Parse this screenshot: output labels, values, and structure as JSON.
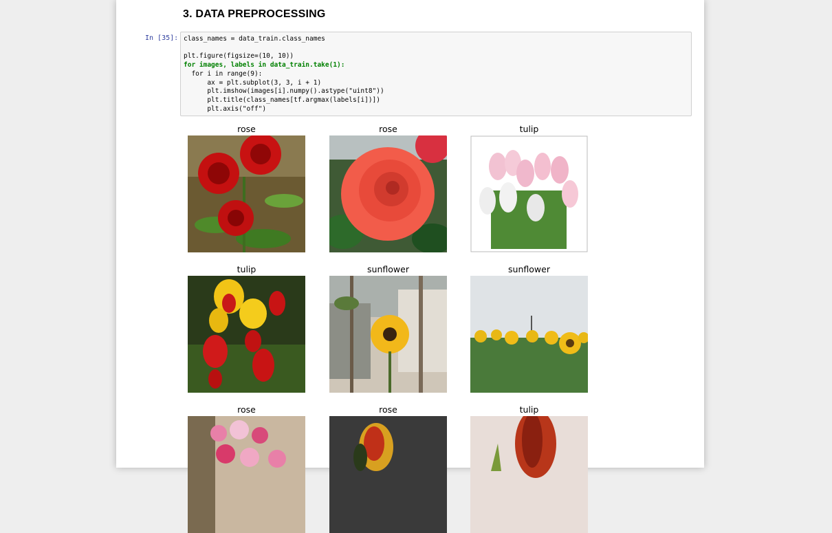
{
  "section": {
    "heading": "3. DATA PREPROCESSING"
  },
  "cell": {
    "prompt": "In [35]:",
    "code_lines": {
      "l1": "class_names = data_train.class_names",
      "l2": "plt.figure(figsize=(10, 10))",
      "l3": "for images, labels in data_train.take(1):",
      "l4": "  for i in range(9):",
      "l5": "      ax = plt.subplot(3, 3, i + 1)",
      "l6": "      plt.imshow(images[i].numpy().astype(\"uint8\"))",
      "l7": "      plt.title(class_names[tf.argmax(labels[i])])",
      "l8": "      plt.axis(\"off\")"
    }
  },
  "output": {
    "images": [
      {
        "title": "rose",
        "icon": "red-roses-image"
      },
      {
        "title": "rose",
        "icon": "orange-rose-image"
      },
      {
        "title": "tulip",
        "icon": "pink-tulips-image"
      },
      {
        "title": "tulip",
        "icon": "red-yellow-tulips-image"
      },
      {
        "title": "sunflower",
        "icon": "single-sunflower-image"
      },
      {
        "title": "sunflower",
        "icon": "sunflower-field-image"
      },
      {
        "title": "rose",
        "icon": "pink-rose-bouquet-image"
      },
      {
        "title": "rose",
        "icon": "yellow-red-rose-image"
      },
      {
        "title": "tulip",
        "icon": "red-tulip-closeup-image"
      }
    ]
  }
}
